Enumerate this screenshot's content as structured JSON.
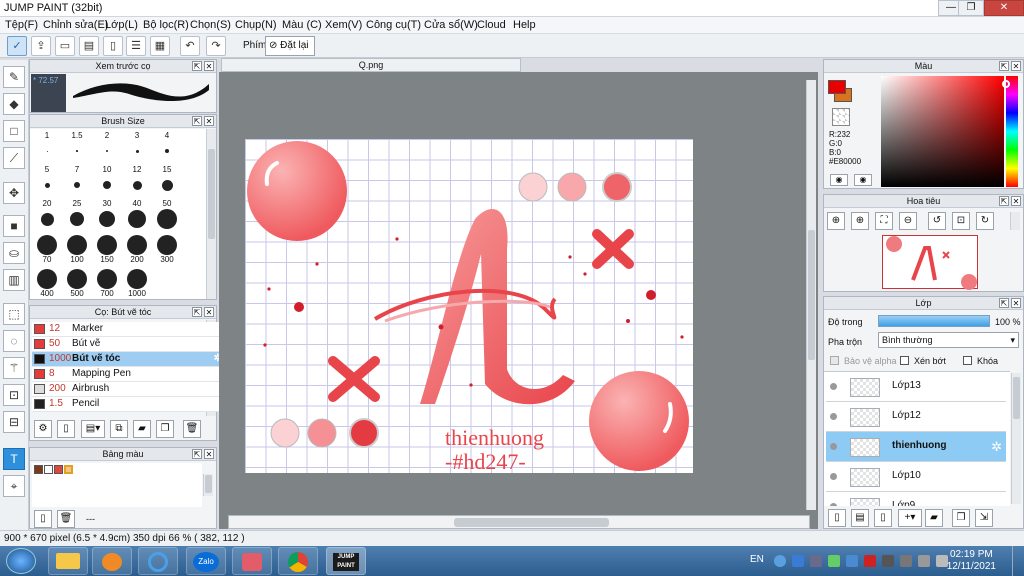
{
  "window": {
    "title": "JUMP PAINT (32bit)",
    "minimize": "—",
    "maximize": "❐",
    "close": "✕"
  },
  "menu": [
    "Tệp(F)",
    "Chỉnh sửa(E)",
    "Lớp(L)",
    "Bộ lọc(R)",
    "Chọn(S)",
    "Chụp(N)",
    "Màu (C)",
    "Xem(V)",
    "Công cụ(T)",
    "Cửa sổ(W)",
    "Cloud",
    "Help"
  ],
  "toolbar": {
    "phim_label": "Phím",
    "reset_label": "Đặt lại"
  },
  "brush_preview": {
    "title": "Xem trước cọ",
    "size_value": "* 72.57"
  },
  "brush_size": {
    "title": "Brush Size",
    "rows": [
      [
        "1",
        "1.5",
        "2",
        "3",
        "4"
      ],
      [
        "5",
        "7",
        "10",
        "12",
        "15"
      ],
      [
        "20",
        "25",
        "30",
        "40",
        "50"
      ],
      [
        "70",
        "100",
        "150",
        "200",
        "300"
      ],
      [
        "400",
        "500",
        "700",
        "1000"
      ]
    ]
  },
  "brush_list": {
    "title": "Cọ: Bút vẽ tóc",
    "items": [
      {
        "size": "12",
        "name": "Marker",
        "color": "#e63b3b"
      },
      {
        "size": "50",
        "name": "Bút vẽ",
        "color": "#e63b3b"
      },
      {
        "size": "1000",
        "name": "Bút vẽ tóc",
        "color": "#111111",
        "selected": true
      },
      {
        "size": "8",
        "name": "Mapping Pen",
        "color": "#e63b3b"
      },
      {
        "size": "200",
        "name": "Airbrush",
        "color": "#dddddd"
      },
      {
        "size": "1.5",
        "name": "Pencil",
        "color": "#222222"
      }
    ]
  },
  "palette": {
    "title": "Bảng màu",
    "footer": "---"
  },
  "document": {
    "tab": "Q.png"
  },
  "canvas_text": {
    "line1": "thienhuong",
    "line2": "-#hd247-"
  },
  "color_panel": {
    "title": "Màu",
    "r": "R:232",
    "g": "G:0",
    "b": "B:0",
    "hex": "#E80000",
    "fg": "#e80000",
    "bg": "#d9721d"
  },
  "navigator": {
    "title": "Hoa tiêu"
  },
  "layers": {
    "title": "Lớp",
    "opacity_label": "Độ trong",
    "opacity_value": "100 %",
    "blend_label": "Pha trộn",
    "blend_value": "Bình thường",
    "protect_alpha": "Bảo vệ alpha",
    "clip": "Xén bớt",
    "lock": "Khóa",
    "items": [
      {
        "name": "Lớp13"
      },
      {
        "name": "Lớp12"
      },
      {
        "name": "thienhuong",
        "selected": true
      },
      {
        "name": "Lớp10"
      },
      {
        "name": "Lớp9"
      }
    ]
  },
  "status": {
    "text": "900 * 670 pixel  (6.5 * 4.9cm)  350 dpi  66 %  ( 382, 112 )"
  },
  "taskbar": {
    "lang": "EN",
    "time": "02:19 PM",
    "date": "12/11/2021",
    "zalo": "Zalo",
    "jump": "JUMP PAINT"
  }
}
